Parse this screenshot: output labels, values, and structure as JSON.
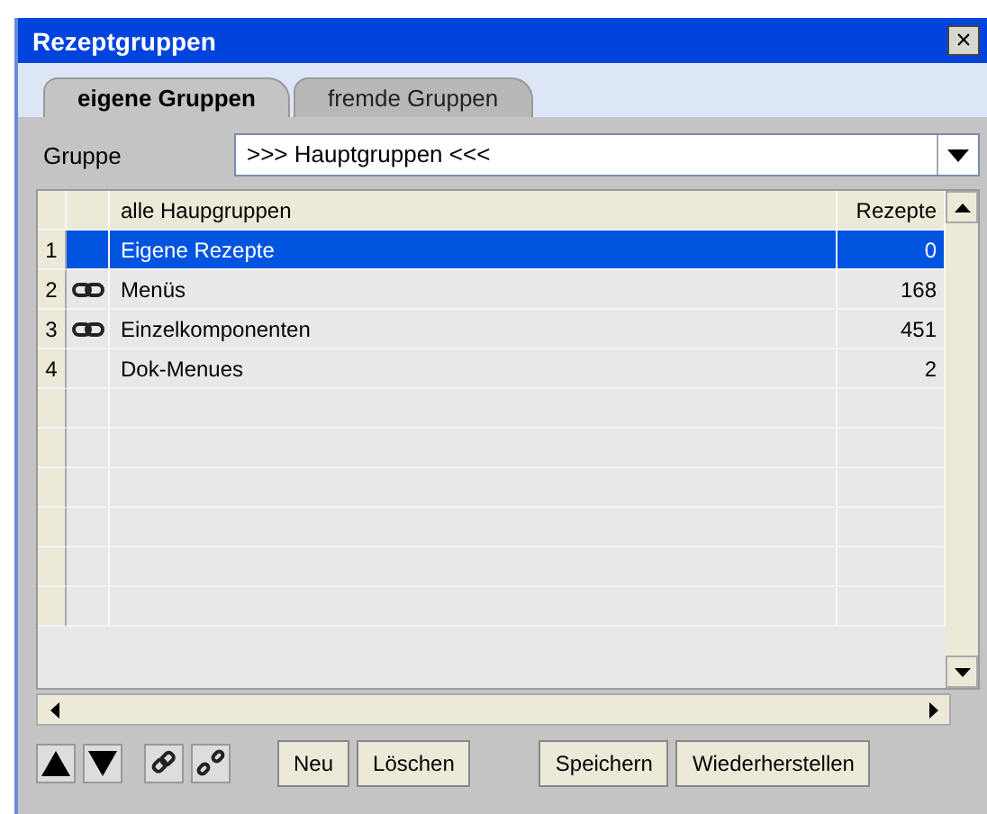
{
  "window": {
    "title": "Rezeptgruppen",
    "close": "×"
  },
  "tabs": [
    {
      "label": "eigene Gruppen",
      "selected": true
    },
    {
      "label": "fremde Gruppen",
      "selected": false
    }
  ],
  "group_field": {
    "label": "Gruppe",
    "value": ">>> Hauptgruppen <<<"
  },
  "table": {
    "columns": [
      "alle Haupgruppen",
      "Rezepte"
    ],
    "rows": [
      {
        "number": "1",
        "linked": false,
        "name": "Eigene Rezepte",
        "count": "0",
        "selected": true
      },
      {
        "number": "2",
        "linked": true,
        "name": "Menüs",
        "count": "168",
        "selected": false
      },
      {
        "number": "3",
        "linked": true,
        "name": "Einzelkomponenten",
        "count": "451",
        "selected": false
      },
      {
        "number": "4",
        "linked": false,
        "name": "Dok-Menues",
        "count": "2",
        "selected": false
      }
    ]
  },
  "buttons": [
    "Neu",
    "Löschen",
    "Speichern",
    "Wiederherstellen"
  ]
}
